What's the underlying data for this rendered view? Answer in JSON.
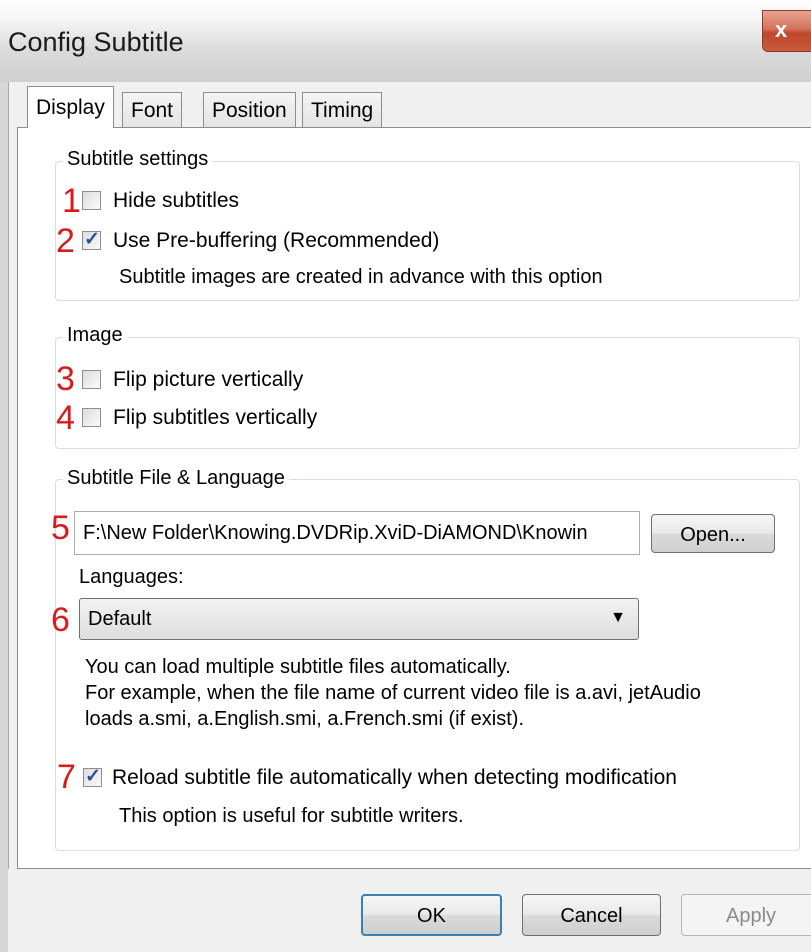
{
  "window": {
    "title": "Config Subtitle",
    "close_glyph": "x"
  },
  "tabs": [
    {
      "label": "Display",
      "active": true
    },
    {
      "label": "Font",
      "active": false
    },
    {
      "label": "Position",
      "active": false
    },
    {
      "label": "Timing",
      "active": false
    }
  ],
  "subtitle_settings": {
    "legend": "Subtitle settings",
    "hide_subtitles": {
      "number": "1",
      "label": "Hide subtitles",
      "checked": false
    },
    "pre_buffering": {
      "number": "2",
      "label": "Use Pre-buffering (Recommended)",
      "checked": true,
      "description": "Subtitle images are created in advance with this option"
    }
  },
  "image": {
    "legend": "Image",
    "flip_picture": {
      "number": "3",
      "label": "Flip picture vertically",
      "checked": false
    },
    "flip_subtitles": {
      "number": "4",
      "label": "Flip subtitles vertically",
      "checked": false
    }
  },
  "file_language": {
    "legend": "Subtitle File & Language",
    "file_number": "5",
    "file_path": "F:\\New Folder\\Knowing.DVDRip.XviD-DiAMOND\\Knowin",
    "open_button": "Open...",
    "languages_label": "Languages:",
    "language_number": "6",
    "language_selected": "Default",
    "info_line1": "You can load multiple subtitle files automatically.",
    "info_line2": "For example, when the file name of current video file is a.avi, jetAudio",
    "info_line3": "loads a.smi, a.English.smi, a.French.smi (if exist).",
    "reload": {
      "number": "7",
      "label": "Reload subtitle file automatically when detecting modification",
      "checked": true,
      "description": "This option is useful for subtitle writers."
    }
  },
  "buttons": {
    "ok": "OK",
    "cancel": "Cancel",
    "apply": "Apply"
  },
  "colors": {
    "annotation_number": "#d81b1b",
    "checkmark": "#264f9a",
    "default_button_border": "#3c7fb1"
  }
}
